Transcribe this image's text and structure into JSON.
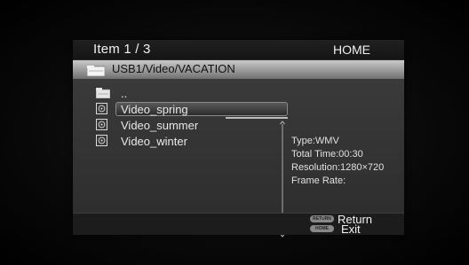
{
  "header": {
    "item_count": "Item 1 / 3",
    "mode": "HOME"
  },
  "path": {
    "text": "USB1/Video/VACATION"
  },
  "list": {
    "items": [
      {
        "label": "..",
        "icon": "parent-folder-icon",
        "selected": false
      },
      {
        "label": "Video_spring",
        "icon": "video-file-icon",
        "selected": true
      },
      {
        "label": "Video_summer",
        "icon": "video-file-icon",
        "selected": false
      },
      {
        "label": "Video_winter",
        "icon": "video-file-icon",
        "selected": false
      }
    ]
  },
  "info": {
    "type": "Type:WMV",
    "total_time": "Total Time:00:30",
    "resolution": "Resolution:1280×720",
    "frame_rate": "Frame Rate:"
  },
  "footer": {
    "return_key": "RETURN",
    "return_label": "Return",
    "home_key": "HOME",
    "exit_label": "Exit"
  },
  "colors": {
    "panel": "#2a2a2a",
    "path_bar": "#a8a8a8",
    "text": "#e8e8e8"
  }
}
